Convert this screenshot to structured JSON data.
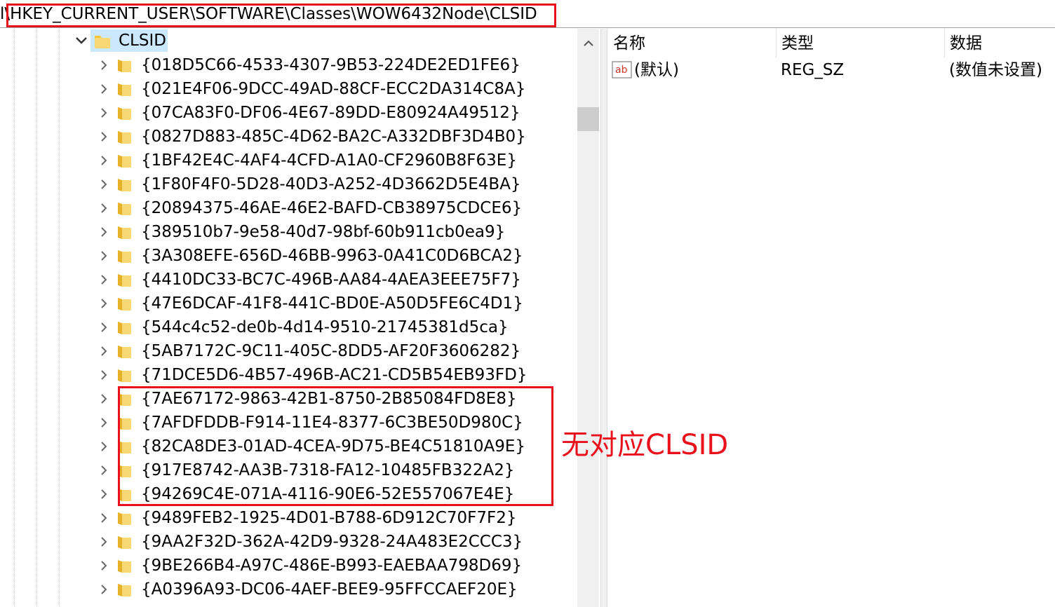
{
  "address_bar": {
    "path": "l\\HKEY_CURRENT_USER\\SOFTWARE\\Classes\\WOW6432Node\\CLSID"
  },
  "tree": {
    "root_label": "CLSID",
    "items": [
      "{018D5C66-4533-4307-9B53-224DE2ED1FE6}",
      "{021E4F06-9DCC-49AD-88CF-ECC2DA314C8A}",
      "{07CA83F0-DF06-4E67-89DD-E80924A49512}",
      "{0827D883-485C-4D62-BA2C-A332DBF3D4B0}",
      "{1BF42E4C-4AF4-4CFD-A1A0-CF2960B8F63E}",
      "{1F80F4F0-5D28-40D3-A252-4D3662D5E4BA}",
      "{20894375-46AE-46E2-BAFD-CB38975CDCE6}",
      "{389510b7-9e58-40d7-98bf-60b911cb0ea9}",
      "{3A308EFE-656D-46BB-9963-0A41C0D6BCA2}",
      "{4410DC33-BC7C-496B-AA84-4AEA3EEE75F7}",
      "{47E6DCAF-41F8-441C-BD0E-A50D5FE6C4D1}",
      "{544c4c52-de0b-4d14-9510-21745381d5ca}",
      "{5AB7172C-9C11-405C-8DD5-AF20F3606282}",
      "{71DCE5D6-4B57-496B-AC21-CD5B54EB93FD}",
      "{7AE67172-9863-42B1-8750-2B85084FD8E8}",
      "{7AFDFDDB-F914-11E4-8377-6C3BE50D980C}",
      "{82CA8DE3-01AD-4CEA-9D75-BE4C51810A9E}",
      "{917E8742-AA3B-7318-FA12-10485FB322A2}",
      "{94269C4E-071A-4116-90E6-52E557067E4E}",
      "{9489FEB2-1925-4D01-B788-6D912C70F7F2}",
      "{9AA2F32D-362A-42D9-9328-24A483E2CCC3}",
      "{9BE266B4-A97C-486E-B993-EAEBAA798D69}",
      "{A0396A93-DC06-4AEF-BEE9-95FFCCAEF20E}"
    ]
  },
  "list": {
    "columns": [
      "名称",
      "类型",
      "数据"
    ],
    "rows": [
      {
        "name": "(默认)",
        "type": "REG_SZ",
        "data": "(数值未设置)"
      }
    ]
  },
  "annotation": {
    "label": "无对应CLSID",
    "color": "#e8111c"
  },
  "colors": {
    "selection": "#cce8ff",
    "folder": "#f4c53a",
    "annotation": "#e8111c"
  }
}
